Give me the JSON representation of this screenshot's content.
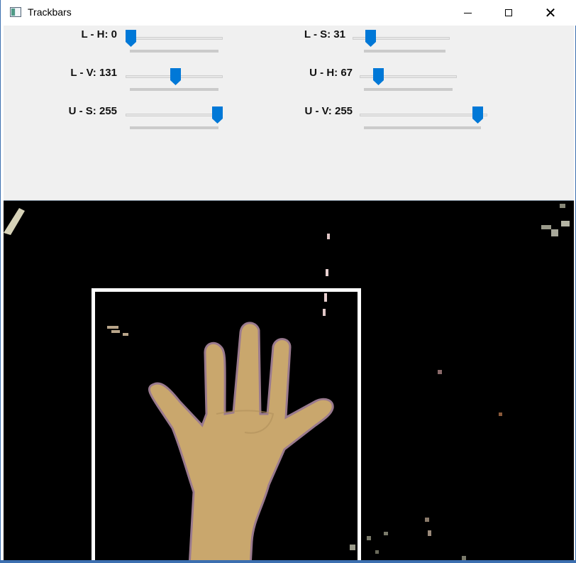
{
  "window": {
    "title": "Trackbars",
    "icon": "app-window-icon",
    "controls": {
      "minimize": "minimize-icon",
      "maximize": "maximize-icon",
      "close_glyph": "✕"
    }
  },
  "trackbars": [
    {
      "id": "l-h",
      "label": "L - H: 0",
      "value": 0,
      "max": 179
    },
    {
      "id": "l-s",
      "label": "L - S: 31",
      "value": 31,
      "max": 255
    },
    {
      "id": "l-v",
      "label": "L - V: 131",
      "value": 131,
      "max": 255
    },
    {
      "id": "u-h",
      "label": "U - H: 67",
      "value": 67,
      "max": 179
    },
    {
      "id": "u-s",
      "label": "U - S: 255",
      "value": 255,
      "max": 255
    },
    {
      "id": "u-v",
      "label": "U - V: 255",
      "value": 255,
      "max": 255
    }
  ],
  "colors": {
    "panel_bg": "#f0f0f0",
    "thumb": "#0078d7",
    "roi_box": "#ffffff",
    "view_bg": "#000000",
    "skin": "#c9a76d"
  }
}
